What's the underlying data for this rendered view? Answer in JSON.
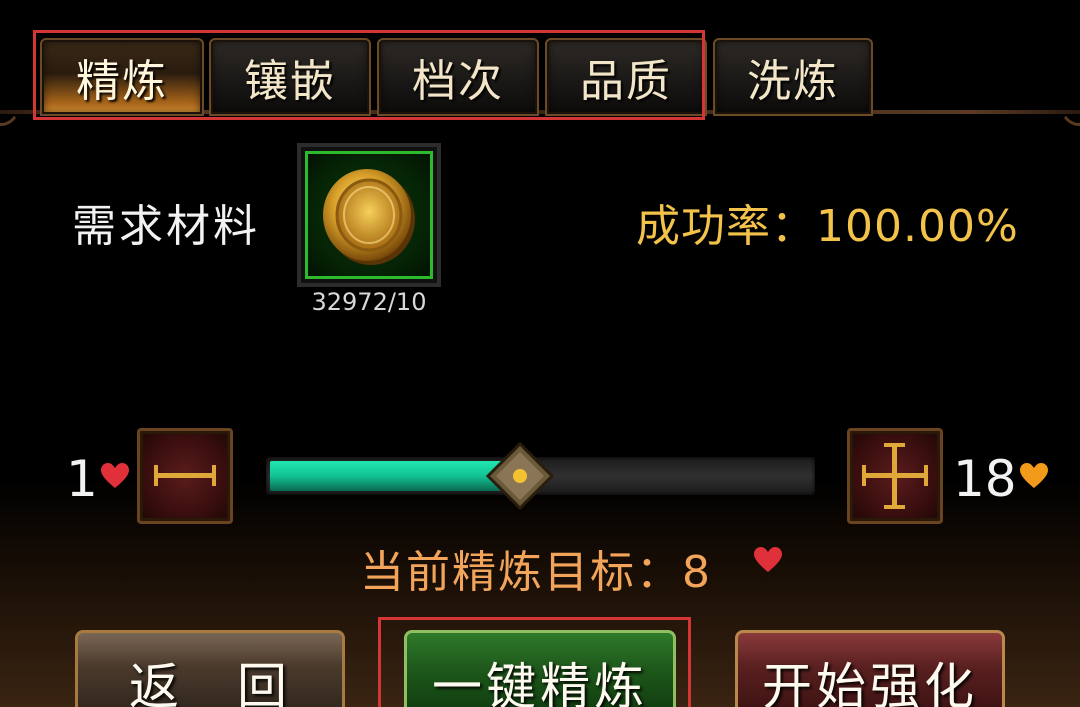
{
  "tabs": [
    {
      "label": "精炼",
      "active": true
    },
    {
      "label": "镶嵌",
      "active": false
    },
    {
      "label": "档次",
      "active": false
    },
    {
      "label": "品质",
      "active": false
    },
    {
      "label": "洗炼",
      "active": false
    }
  ],
  "materials": {
    "label": "需求材料",
    "item_icon": "gold-coin-icon",
    "count": "32972/10"
  },
  "success_rate": "成功率：100.00%",
  "slider": {
    "min": "1",
    "max": "18",
    "value": 8,
    "minus_icon": "minus-icon",
    "plus_icon": "plus-icon"
  },
  "target_text": "当前精炼目标：8",
  "buttons": {
    "back": "返　回",
    "one_click_refine": "一键精炼",
    "start_strengthen": "开始强化"
  },
  "colors": {
    "accent_gold": "#f2c24a",
    "target_orange": "#f2a55a",
    "slider_green": "#12c394",
    "highlight_red": "#d43636",
    "heart_red": "#e0303a",
    "heart_orange": "#f29a1a"
  }
}
